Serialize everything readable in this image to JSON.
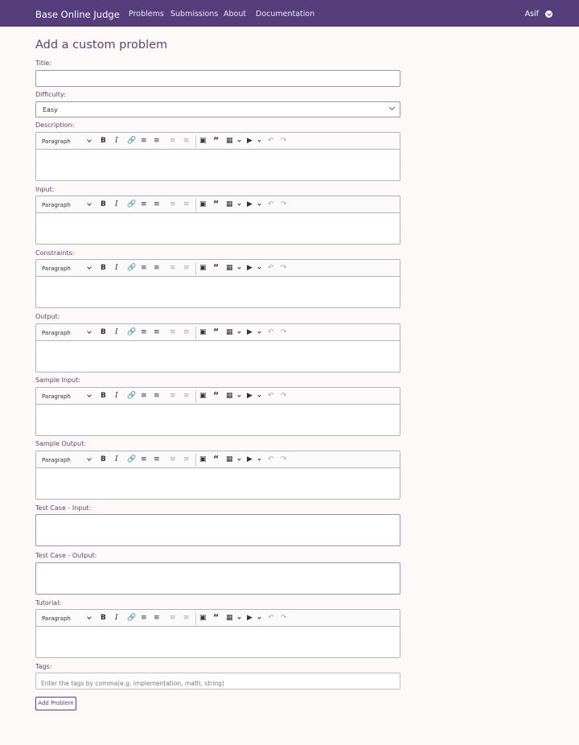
{
  "navbar": {
    "brand": "Base Online Judge",
    "links": [
      "Problems",
      "Submissions",
      "About",
      "Documentation"
    ],
    "user": "Asif"
  },
  "page": {
    "title": "Add a custom problem"
  },
  "fields": {
    "title_label": "Title:",
    "title_value": "",
    "difficulty_label": "Difficulty:",
    "difficulty_value": "Easy",
    "description_label": "Description:",
    "input_label": "Input:",
    "constraints_label": "Constraints:",
    "output_label": "Output:",
    "sample_input_label": "Sample Input:",
    "sample_output_label": "Sample Output:",
    "testcase_input_label": "Test Case - Input:",
    "testcase_output_label": "Test Case - Output:",
    "tutorial_label": "Tutorial:",
    "tags_label": "Tags:",
    "tags_placeholder": "Enter the tags by comma(e.g. implementation, math, string)"
  },
  "editor_toolbar": {
    "paragraph": "Paragraph",
    "icons": [
      "paragraph-dropdown",
      "bold-icon",
      "italic-icon",
      "link-icon",
      "bulleted-list-icon",
      "numbered-list-icon",
      "outdent-icon",
      "indent-icon",
      "image-icon",
      "blockquote-icon",
      "table-icon",
      "media-icon",
      "undo-icon",
      "redo-icon"
    ]
  },
  "submit_label": "Add Problem"
}
